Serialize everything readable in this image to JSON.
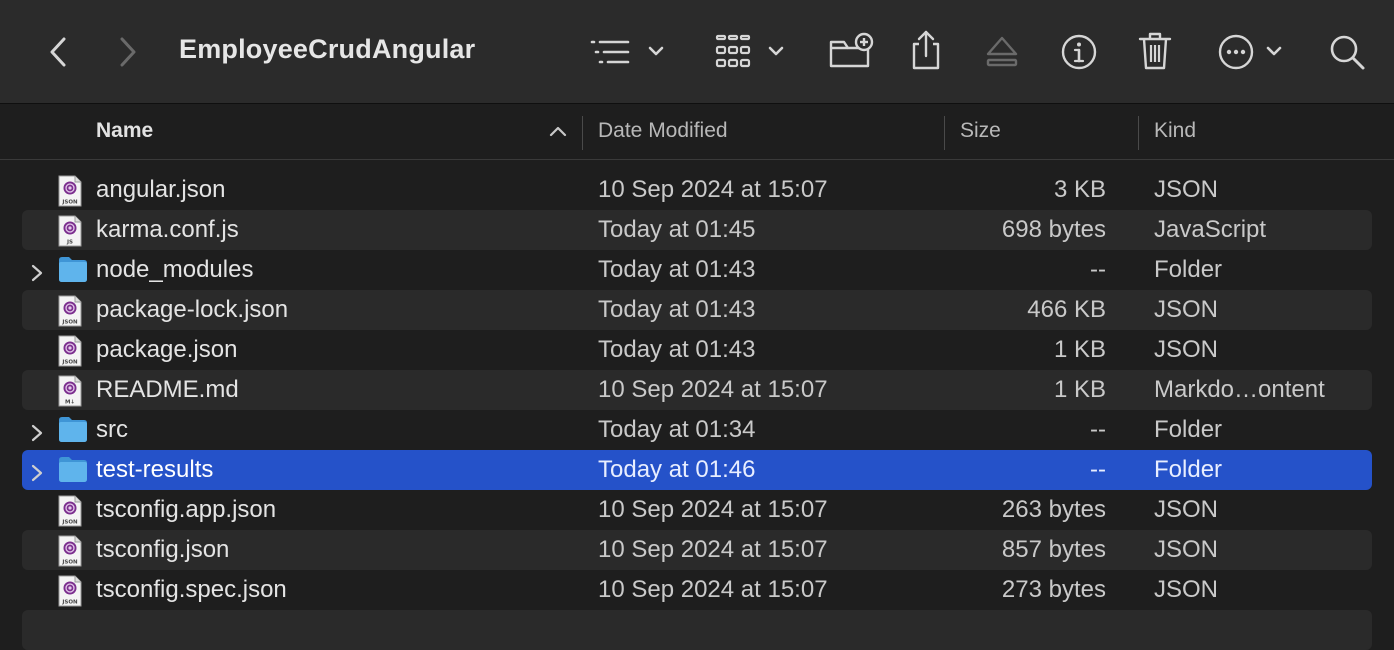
{
  "window": {
    "title": "EmployeeCrudAngular"
  },
  "columns": {
    "name": "Name",
    "date_modified": "Date Modified",
    "size": "Size",
    "kind": "Kind",
    "sort_indicator": "ascending"
  },
  "toolbar_icons": [
    "back-icon",
    "forward-icon",
    "list-view-icon",
    "grid-view-icon",
    "new-folder-icon",
    "share-icon",
    "eject-icon",
    "info-icon",
    "trash-icon",
    "more-icon",
    "search-icon"
  ],
  "colors": {
    "selection": "#2552c9",
    "folder": "#5fb4ec",
    "toolbar": "#2b2b2b",
    "background": "#1e1e1e"
  },
  "files": [
    {
      "name": "angular.json",
      "date": "10 Sep 2024 at 15:07",
      "size": "3 KB",
      "kind": "JSON",
      "type": "file",
      "badge": "JSON"
    },
    {
      "name": "karma.conf.js",
      "date": "Today at 01:45",
      "size": "698 bytes",
      "kind": "JavaScript",
      "type": "file",
      "badge": "JS"
    },
    {
      "name": "node_modules",
      "date": "Today at 01:43",
      "size": "--",
      "kind": "Folder",
      "type": "folder"
    },
    {
      "name": "package-lock.json",
      "date": "Today at 01:43",
      "size": "466 KB",
      "kind": "JSON",
      "type": "file",
      "badge": "JSON"
    },
    {
      "name": "package.json",
      "date": "Today at 01:43",
      "size": "1 KB",
      "kind": "JSON",
      "type": "file",
      "badge": "JSON"
    },
    {
      "name": "README.md",
      "date": "10 Sep 2024 at 15:07",
      "size": "1 KB",
      "kind": "Markdo…ontent",
      "type": "file",
      "badge": "M↓"
    },
    {
      "name": "src",
      "date": "Today at 01:34",
      "size": "--",
      "kind": "Folder",
      "type": "folder"
    },
    {
      "name": "test-results",
      "date": "Today at 01:46",
      "size": "--",
      "kind": "Folder",
      "type": "folder",
      "selected": true
    },
    {
      "name": "tsconfig.app.json",
      "date": "10 Sep 2024 at 15:07",
      "size": "263 bytes",
      "kind": "JSON",
      "type": "file",
      "badge": "JSON"
    },
    {
      "name": "tsconfig.json",
      "date": "10 Sep 2024 at 15:07",
      "size": "857 bytes",
      "kind": "JSON",
      "type": "file",
      "badge": "JSON"
    },
    {
      "name": "tsconfig.spec.json",
      "date": "10 Sep 2024 at 15:07",
      "size": "273 bytes",
      "kind": "JSON",
      "type": "file",
      "badge": "JSON"
    }
  ]
}
